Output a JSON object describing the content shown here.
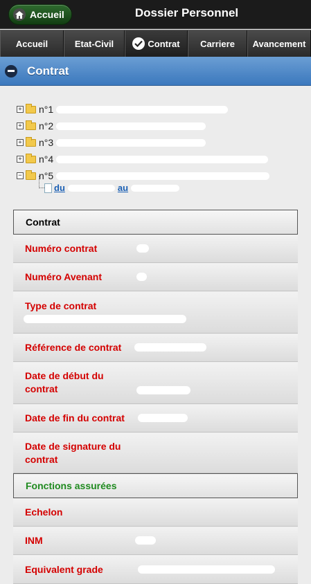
{
  "header": {
    "home_label": "Accueil",
    "title": "Dossier Personnel"
  },
  "nav": {
    "tabs": [
      "Accueil",
      "Etat-Civil",
      "Contrat",
      "Carriere",
      "Avancement"
    ],
    "active": "Contrat"
  },
  "section": {
    "title": "Contrat"
  },
  "tree": {
    "items": [
      {
        "expander": "+",
        "label": "n°1"
      },
      {
        "expander": "+",
        "label": "n°2"
      },
      {
        "expander": "+",
        "label": "n°3"
      },
      {
        "expander": "+",
        "label": "n°4"
      },
      {
        "expander": "−",
        "label": "n°5"
      }
    ],
    "leaf": {
      "prefix": "du",
      "middle": "au"
    }
  },
  "contrat": {
    "group_title": "Contrat",
    "fields": [
      "Numéro contrat",
      "Numéro Avenant",
      "Type de contrat",
      "Référence de contrat",
      "Date de début du contrat",
      "Date de fin du contrat",
      "Date de signature du contrat"
    ]
  },
  "fonctions": {
    "group_title": "Fonctions assurées",
    "fields": [
      "Echelon",
      "INM",
      "Equivalent grade"
    ]
  },
  "colors": {
    "label_red": "#d40000",
    "group_green": "#1f8a1f",
    "section_blue": "#3b78bd"
  }
}
